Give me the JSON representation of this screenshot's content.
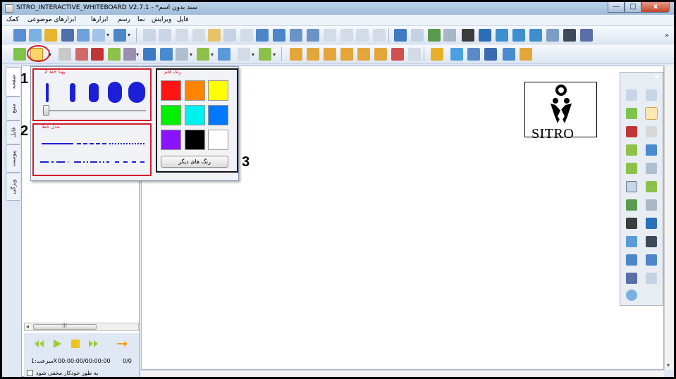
{
  "window": {
    "title": "SITRO_INTERACTIVE_WHITEBOARD V2.7.1 - *سند بدون اسم",
    "min": "—",
    "max": "□",
    "close": "x"
  },
  "menu": {
    "items": [
      "کمک",
      "ابزارهای موضوعی",
      "ابزارها",
      "رسم",
      "نما",
      "ویرایش",
      "فایل"
    ]
  },
  "side_tabs": [
    "صفحه",
    "منبع",
    "فایل",
    "پیوست",
    "ویژگی"
  ],
  "popup": {
    "width_group_label": "پهنا خط 2",
    "style_group_label": "مدل خط",
    "color_group_label": "رنگ قلم",
    "more_colors_label": "رنگ های دیگر",
    "callouts": [
      "1",
      "2",
      "3"
    ],
    "line_width_value": 2,
    "colors": [
      "#ff1414",
      "#ff8400",
      "#ffff00",
      "#00f000",
      "#00f0f0",
      "#0078ff",
      "#8a14ff",
      "#000000",
      "#ffffff"
    ]
  },
  "playback": {
    "speed_label": "سرعت:1X",
    "time": "00:00:00/00:00:00",
    "count": "0/0",
    "autohide_label": "به طور خودکار مخفی شود"
  },
  "logo": {
    "text": "SITRO"
  },
  "scroll": {
    "thumb_grip": "III",
    "left_arrow": "◂",
    "down_arrow": "▾"
  },
  "toolbar_overflow": "»",
  "colors": {
    "accent_red": "#d11d2c",
    "pen_blue": "#1b1fd6"
  }
}
